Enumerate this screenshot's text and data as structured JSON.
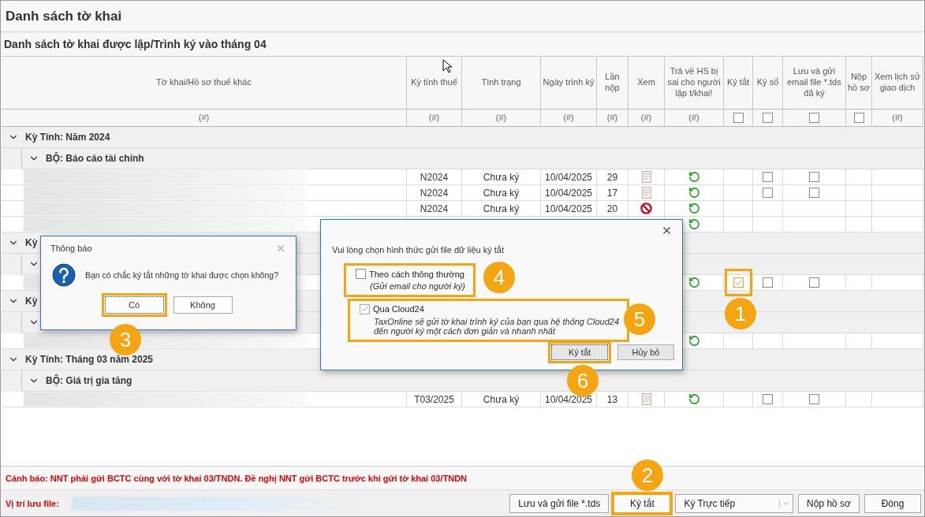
{
  "window": {
    "title": "Danh sách tờ khai"
  },
  "subtitle": "Danh sách tờ khai được lập/Trình ký vào tháng 04",
  "columns": [
    {
      "label": "Tờ khai/Hồ sơ thuế khác",
      "kind": "text",
      "filter": "(#)"
    },
    {
      "label": "Kỳ tính thuế",
      "kind": "text",
      "filter": "(#)"
    },
    {
      "label": "Tình trạng",
      "kind": "text",
      "filter": "(#)"
    },
    {
      "label": "Ngày trình ký",
      "kind": "text",
      "filter": "(#)"
    },
    {
      "label": "Lần nộp",
      "kind": "text",
      "filter": "(#)"
    },
    {
      "label": "Xem",
      "kind": "text",
      "filter": "(#)"
    },
    {
      "label": "Trả về HS bị sai cho người lập t/khai!",
      "kind": "text",
      "filter": "(#)"
    },
    {
      "label": "Ký tắt",
      "kind": "check",
      "checked": false
    },
    {
      "label": "Ký số",
      "kind": "check",
      "checked": false
    },
    {
      "label": "Lưu và gửi email file *.tds đã ký",
      "kind": "check",
      "checked": false
    },
    {
      "label": "Nộp hồ sơ",
      "kind": "check",
      "checked": false
    },
    {
      "label": "Xem lịch sử giao dịch",
      "kind": "text",
      "filter": "(#)"
    }
  ],
  "rows": [
    {
      "kind": "group",
      "label": "Kỳ Tính: Năm 2024"
    },
    {
      "kind": "subgroup",
      "label": "BỘ: Báo cáo tài chính"
    },
    {
      "kind": "data",
      "period": "N2024",
      "status": "Chưa ký",
      "date": "10/04/2025",
      "count": "29",
      "view": {
        "kind": "document"
      },
      "returnable": true,
      "sign_digital": {
        "checked": false
      },
      "save_email": {
        "checked": false
      }
    },
    {
      "kind": "data",
      "period": "N2024",
      "status": "Chưa ký",
      "date": "10/04/2025",
      "count": "17",
      "view": {
        "kind": "document"
      },
      "returnable": true,
      "sign_digital": {
        "checked": false
      },
      "save_email": {
        "checked": false
      }
    },
    {
      "kind": "data",
      "period": "N2024",
      "status": "Chưa ký",
      "date": "10/04/2025",
      "count": "20",
      "view": {
        "kind": "blocked"
      },
      "returnable": true
    },
    {
      "kind": "data",
      "returnable": true
    },
    {
      "kind": "group",
      "label": "Kỳ"
    },
    {
      "kind": "subgroup"
    },
    {
      "kind": "data",
      "returnable": true,
      "sign_quick": {
        "checked": true,
        "highlighted": true
      },
      "sign_digital": {
        "checked": false
      },
      "save_email": {
        "checked": false
      }
    },
    {
      "kind": "group",
      "label": "Kỳ"
    },
    {
      "kind": "subgroup"
    },
    {
      "kind": "data",
      "returnable": true
    },
    {
      "kind": "group",
      "label": "Kỳ Tính: Tháng 03 năm 2025"
    },
    {
      "kind": "subgroup",
      "label": "BỘ: Giá trị gia tăng"
    },
    {
      "kind": "data",
      "period": "T03/2025",
      "status": "Chưa ký",
      "date": "10/04/2025",
      "count": "13",
      "view": {
        "kind": "document"
      },
      "returnable": true,
      "sign_digital": {
        "checked": false
      },
      "save_email": {
        "checked": false
      }
    }
  ],
  "warning": "Cảnh báo: NNT phải gửi BCTC cùng với tờ khai 03/TNDN. Đề nghị NNT gửi BCTC trước khi gửi tờ khai 03/TNDN",
  "footer": {
    "path_label": "Vị trí lưu file:",
    "buttons": [
      {
        "label": "Lưu và gửi file *.tds",
        "kind": "plain",
        "highlighted": false
      },
      {
        "label": "Ký tắt",
        "kind": "plain",
        "highlighted": true
      },
      {
        "label": "Ký Trực tiếp",
        "kind": "split",
        "highlighted": false
      },
      {
        "label": "Nộp hồ sơ",
        "kind": "plain",
        "highlighted": false
      },
      {
        "label": "Đóng",
        "kind": "plain",
        "highlighted": false
      }
    ]
  },
  "confirm_dialog": {
    "title": "Thông báo",
    "message": "Bạn có chắc ký tắt những tờ khai được chọn không?",
    "buttons": [
      {
        "label": "Có",
        "highlighted": true
      },
      {
        "label": "Không",
        "highlighted": false
      }
    ]
  },
  "send_dialog": {
    "prompt": "Vui lòng chọn hình thức gửi file dữ liệu ký tắt",
    "options": [
      {
        "label": "Theo cách thông thường",
        "description": "(Gửi email cho người ký)",
        "checked": false,
        "highlighted": true
      },
      {
        "label": "Qua Cloud24",
        "description": "TaxOnline sẽ gửi tờ khai trình ký của bạn qua hệ thống Cloud24\nđến người ký một cách đơn giản và nhanh nhất",
        "checked": true,
        "highlighted": true
      }
    ],
    "buttons": [
      {
        "label": "Ký tắt",
        "highlighted": true
      },
      {
        "label": "Hủy bỏ",
        "highlighted": false
      }
    ]
  },
  "callouts": [
    "1",
    "2",
    "3",
    "4",
    "5",
    "6"
  ]
}
